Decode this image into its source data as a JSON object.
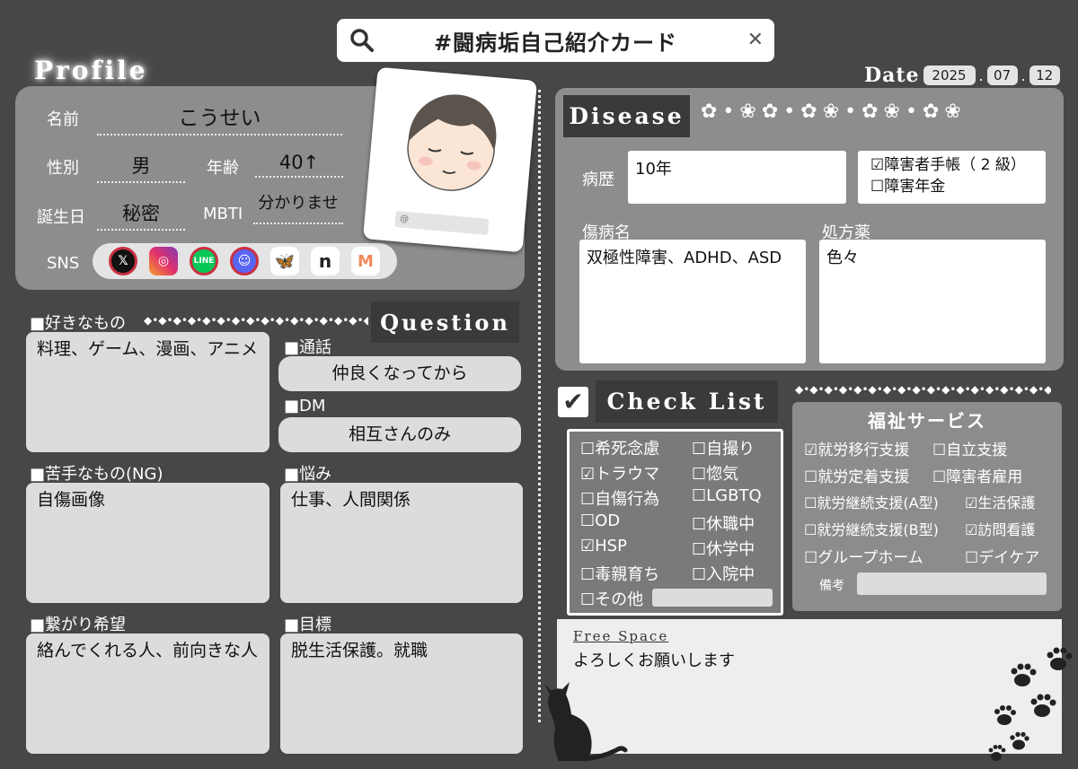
{
  "search": {
    "title": "#闘病垢自己紹介カード",
    "close": "✕"
  },
  "profile": {
    "heading": "Profile",
    "name_label": "名前",
    "name": "こうせい",
    "gender_label": "性別",
    "gender": "男",
    "age_label": "年齢",
    "age": "40↑",
    "birthday_label": "誕生日",
    "birthday": "秘密",
    "mbti_label": "MBTI",
    "mbti": "分かりませ",
    "sns_label": "SNS",
    "photo_at": "@"
  },
  "date": {
    "label": "Date",
    "year": "2025",
    "month": "07",
    "day": "12",
    "sep": "."
  },
  "likes": {
    "heading": "■好きなもの",
    "text": "料理、ゲーム、漫画、アニメ"
  },
  "question": {
    "heading": "Question"
  },
  "call": {
    "heading": "■通話",
    "text": "仲良くなってから"
  },
  "dm": {
    "heading": "■DM",
    "text": "相互さんのみ"
  },
  "dislikes": {
    "heading": "■苦手なもの(NG)",
    "text": "自傷画像"
  },
  "worries": {
    "heading": "■悩み",
    "text": "仕事、人間関係"
  },
  "connect": {
    "heading": "■繋がり希望",
    "text": "絡んでくれる人、前向きな人"
  },
  "goal": {
    "heading": "■目標",
    "text": "脱生活保護。就職"
  },
  "disease": {
    "heading": "Disease",
    "history_label": "病歴",
    "history": "10年",
    "techo": "☑障害者手帳（ 2 級）",
    "pension": "☐障害年金",
    "name_label": "傷病名",
    "name": "双極性障害、ADHD、ASD",
    "med_label": "処方薬",
    "med": "色々"
  },
  "checklist": {
    "heading": "Check List",
    "check_mark": "✔",
    "items": [
      "☐希死念慮",
      "☐自撮り",
      "☑トラウマ",
      "☐惚気",
      "☐自傷行為",
      "☐LGBTQ",
      "☐OD",
      "☐休職中",
      "☑HSP",
      "☐休学中",
      "☐毒親育ち",
      "☐入院中",
      "☐その他"
    ]
  },
  "welfare": {
    "heading": "福祉サービス",
    "items": [
      "☑就労移行支援",
      "☐自立支援",
      "☐就労定着支援",
      "☐障害者雇用",
      "☐就労継続支援(A型)",
      "☑生活保護",
      "☐就労継続支援(B型)",
      "☑訪問看護",
      "☐グループホーム",
      "☐デイケア"
    ],
    "note_label": "備考"
  },
  "free": {
    "heading": "Free Space",
    "text": "よろしくお願いします"
  },
  "sns_icons": [
    "x-icon",
    "instagram-icon",
    "line-icon",
    "discord-icon",
    "bluesky-icon",
    "note-icon",
    "misskey-icon"
  ],
  "colors": {
    "bg": "#474747",
    "panel": "#8d8d8d",
    "box": "#dcdcdc"
  }
}
